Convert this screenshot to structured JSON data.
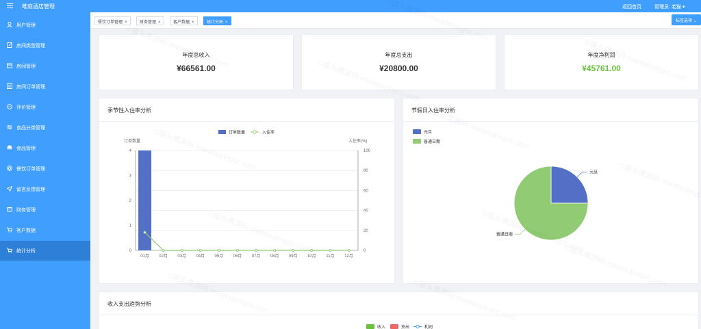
{
  "header": {
    "title": "唯庭酒店管理",
    "home_link": "返回首页",
    "user_label": "管理员: 老猫"
  },
  "sidebar": {
    "items": [
      {
        "label": "用户管理",
        "icon": "user-icon"
      },
      {
        "label": "房间类型管理",
        "icon": "edit-icon"
      },
      {
        "label": "房间管理",
        "icon": "room-icon"
      },
      {
        "label": "房间订单管理",
        "icon": "order-icon"
      },
      {
        "label": "评价管理",
        "icon": "chat-icon"
      },
      {
        "label": "食品分类管理",
        "icon": "sliders-icon"
      },
      {
        "label": "食品管理",
        "icon": "food-icon"
      },
      {
        "label": "餐饮订单管理",
        "icon": "dining-icon"
      },
      {
        "label": "留言反馈管理",
        "icon": "send-icon"
      },
      {
        "label": "财务管理",
        "icon": "finance-icon"
      },
      {
        "label": "客户数据",
        "icon": "cart-icon"
      },
      {
        "label": "统计分析",
        "icon": "stats-icon"
      }
    ]
  },
  "tabs": [
    {
      "label": "餐饮订单管理",
      "close": "×"
    },
    {
      "label": "财务管理",
      "close": "×"
    },
    {
      "label": "客户数据",
      "close": "×"
    },
    {
      "label": "统计分析",
      "close": "×"
    }
  ],
  "tab_options_label": "标签选项",
  "stats": {
    "income_label": "年度总收入",
    "income_value": "¥66561.00",
    "expense_label": "年度总支出",
    "expense_value": "¥20800.00",
    "profit_label": "年度净利润",
    "profit_value": "¥45761.00"
  },
  "watermark": "©猫头鹰源码 maotouyingcc.com",
  "colors": {
    "primary": "#409eff",
    "bar": "#5470c6",
    "line": "#91cc75",
    "profit": "#67c23a",
    "expense": "#ee6666"
  },
  "chart_data": [
    {
      "type": "bar",
      "title": "季节性入住率分析",
      "categories": [
        "01月",
        "02月",
        "03月",
        "04月",
        "05月",
        "06月",
        "07月",
        "08月",
        "09月",
        "10月",
        "11月",
        "12月"
      ],
      "series": [
        {
          "name": "订单数量",
          "type": "bar",
          "values": [
            4,
            0,
            0,
            0,
            0,
            0,
            0,
            0,
            0,
            0,
            0,
            0
          ]
        },
        {
          "name": "入住率",
          "type": "line",
          "values": [
            18,
            0,
            0,
            0,
            0,
            0,
            0,
            0,
            0,
            0,
            0,
            0
          ]
        }
      ],
      "ylabel": "订单数量",
      "ylim": [
        0,
        4
      ],
      "yticks": [
        "0",
        "1",
        "2",
        "3",
        "4"
      ],
      "y2label": "入住率(%)",
      "y2lim": [
        0,
        100
      ],
      "y2ticks": [
        "0",
        "20",
        "40",
        "60",
        "80",
        "100"
      ],
      "legend": "top-center",
      "grid": true
    },
    {
      "type": "pie",
      "title": "节假日入住率分析",
      "slices": [
        {
          "name": "元旦",
          "value": 1
        },
        {
          "name": "普通日期",
          "value": 3
        }
      ],
      "legend": "top-left"
    },
    {
      "type": "line",
      "title": "收入支出趋势分析",
      "series": [
        {
          "name": "收入",
          "type": "bar"
        },
        {
          "name": "支出",
          "type": "bar"
        },
        {
          "name": "利润",
          "type": "line"
        }
      ],
      "legend": "top-center"
    }
  ]
}
